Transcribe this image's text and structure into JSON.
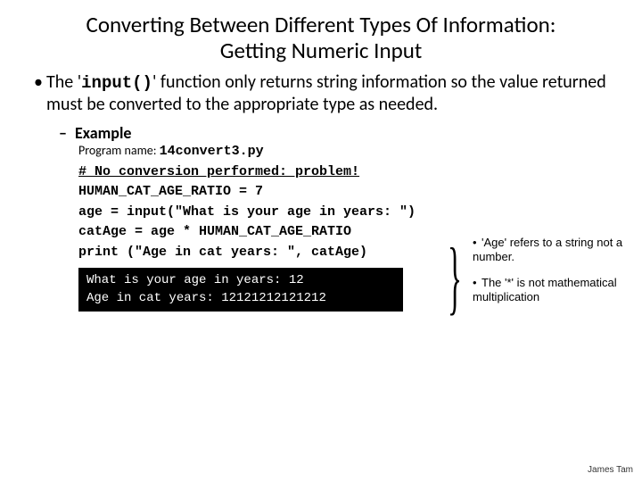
{
  "title_line1": "Converting Between Different Types Of Information:",
  "title_line2": "Getting Numeric Input",
  "main_bullet_pre": "The '",
  "main_bullet_code": "input()",
  "main_bullet_post": "' function only returns string information so the value returned must be converted to the appropriate type as needed.",
  "example_label": "Example",
  "program_label": "Program name: ",
  "program_name": "14convert3.py",
  "code": {
    "l1": "# No conversion performed: problem!",
    "l2": "HUMAN_CAT_AGE_RATIO = 7",
    "l3": "age = input(\"What is your age in years: \")",
    "l4": "catAge = age * HUMAN_CAT_AGE_RATIO",
    "l5": "print (\"Age in cat years: \", catAge)"
  },
  "terminal": {
    "l1": "What is your age in years: 12",
    "l2": "Age in cat years:  12121212121212"
  },
  "annot1": "'Age' refers to a string not a number.",
  "annot2": "The '*' is not mathematical multiplication",
  "footer": "James Tam"
}
